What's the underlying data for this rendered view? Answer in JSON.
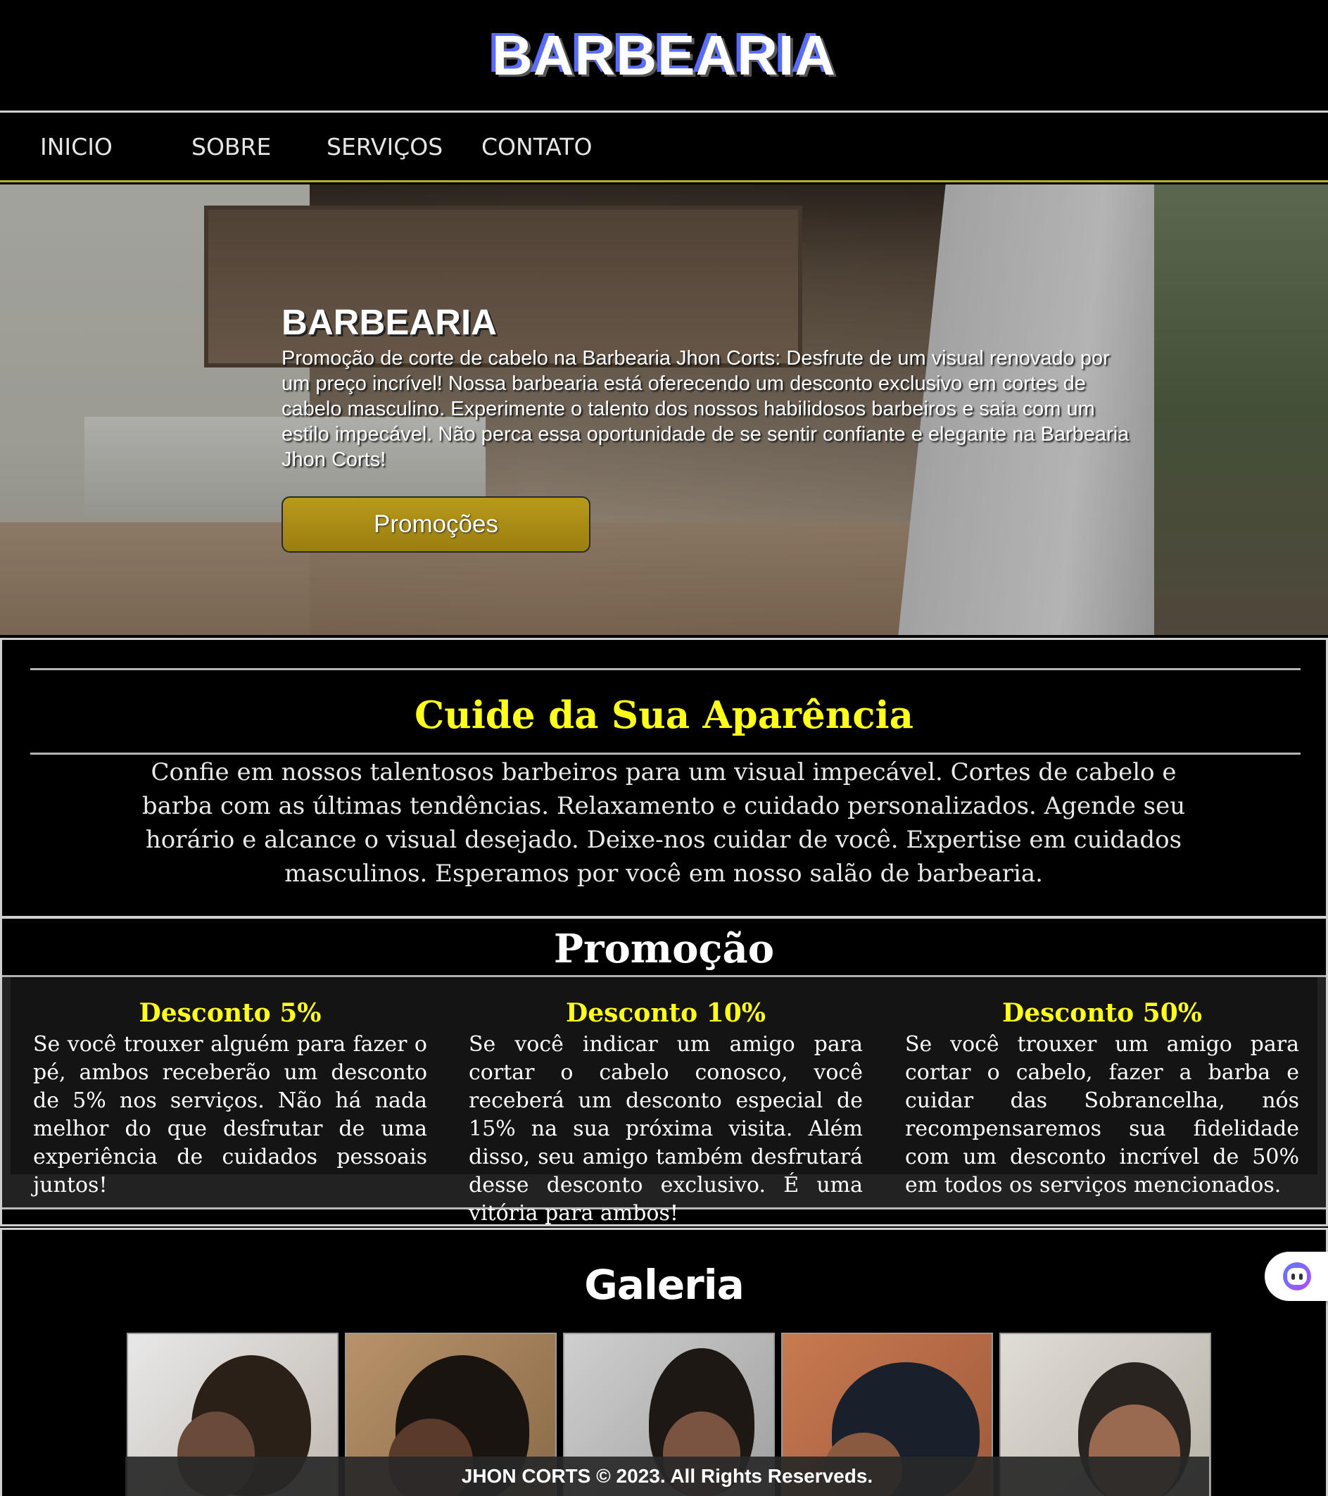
{
  "header": {
    "title": "BARBEARIA"
  },
  "nav": {
    "items": [
      "INICIO",
      "SOBRE",
      "SERVIÇOS",
      "CONTATO"
    ]
  },
  "hero": {
    "title": "BARBEARIA",
    "text": "Promoção de corte de cabelo na Barbearia Jhon Corts: Desfrute de um visual renovado por um preço incrível! Nossa barbearia está oferecendo um desconto exclusivo em cortes de cabelo masculino. Experimente o talento dos nossos habilidosos barbeiros e saia com um estilo impecável. Não perca essa oportunidade de se sentir confiante e elegante na Barbearia Jhon Corts!",
    "button_label": "Promoções"
  },
  "care": {
    "title": "Cuide da Sua Aparência",
    "text": "Confie em nossos talentosos barbeiros para um visual impecável. Cortes de cabelo e barba com as últimas tendências. Relaxamento e cuidado personalizados. Agende seu horário e alcance o visual desejado. Deixe-nos cuidar de você. Expertise em cuidados masculinos. Esperamos por você em nosso salão de barbearia."
  },
  "promo": {
    "title": "Promoção",
    "cards": [
      {
        "title": "Desconto 5%",
        "text": "Se você trouxer alguém para fazer o pé, ambos receberão um desconto de 5% nos serviços. Não há nada melhor do que desfrutar de uma experiência de cuidados pessoais juntos!"
      },
      {
        "title": "Desconto 10%",
        "text": "Se você indicar um amigo para cortar o cabelo conosco, você receberá um desconto especial de 15% na sua próxima visita. Além disso, seu amigo também desfrutará desse desconto exclusivo. É uma vitória para ambos!"
      },
      {
        "title": "Desconto 50%",
        "text": "Se você trouxer um amigo para cortar o cabelo, fazer a barba e cuidar das Sobrancelha, nós recompensaremos sua fidelidade com um desconto incrível de 50% em todos os serviços mencionados."
      }
    ]
  },
  "gallery": {
    "title": "Galeria"
  },
  "footer": {
    "text": "JHON CORTS © 2023. All Rights Reserveds."
  },
  "icons": {
    "chat": "chat-assistant-icon"
  },
  "colors": {
    "accent_yellow": "#ffff1a",
    "button_gold": "#b89a1a",
    "background": "#000000"
  }
}
